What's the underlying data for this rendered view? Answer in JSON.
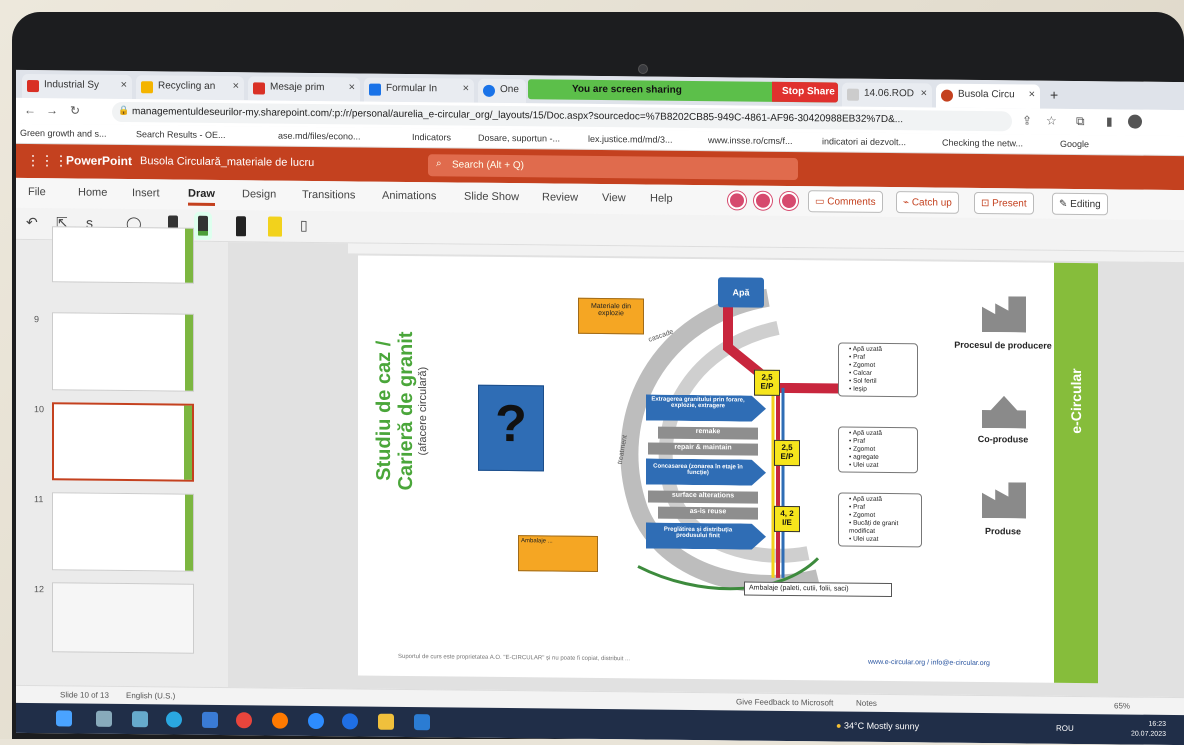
{
  "browser": {
    "tabs": [
      {
        "label": "Industrial Sy",
        "color": "#d93025"
      },
      {
        "label": "Recycling an",
        "color": "#f4b400"
      },
      {
        "label": "Mesaje prim",
        "color": "#d93025"
      },
      {
        "label": "Formular In",
        "color": "#1a73e8"
      },
      {
        "label": "One",
        "color": "#1a73e8"
      },
      {
        "label": "14.06.ROD",
        "color": "#cccccc"
      },
      {
        "label": "Busola Circu",
        "color": "#c4411f"
      }
    ],
    "share_banner": "You are screen sharing",
    "stop_share": "Stop Share",
    "url": "managementuldeseurilor-my.sharepoint.com/:p:/r/personal/aurelia_e-circular_org/_layouts/15/Doc.aspx?sourcedoc=%7B8202CB85-949C-4861-AF96-30420988EB32%7D&...",
    "bookmarks": [
      "Green growth and s...",
      "Search Results - OE...",
      "ase.md/files/econo...",
      "Indicators",
      "Dosare, suportun -...",
      "lex.justice.md/md/3...",
      "www.insse.ro/cms/f...",
      "indicatori ai dezvolt...",
      "Checking the netw...",
      "Google"
    ]
  },
  "powerpoint": {
    "app_name": "PowerPoint",
    "doc_title": "Busola Circulară_materiale de lucru",
    "search_placeholder": "Search (Alt + Q)",
    "ribbon_tabs": [
      "File",
      "Home",
      "Insert",
      "Draw",
      "Design",
      "Transitions",
      "Animations",
      "Slide Show",
      "Review",
      "View",
      "Help"
    ],
    "active_tab": "Draw",
    "buttons": {
      "comments": "Comments",
      "catch_up": "Catch up",
      "present": "Present",
      "editing": "Editing"
    }
  },
  "thumbnails": [
    {
      "num": "9"
    },
    {
      "num": "10",
      "selected": true
    },
    {
      "num": "11"
    },
    {
      "num": "12"
    }
  ],
  "slide": {
    "title_line1": "Studiu de caz /",
    "title_line2": "Carieră de granit",
    "subtitle": "(afacere circulară)",
    "question_mark": "?",
    "top_box": "Apă",
    "orange_box": "Materiale din explozie",
    "arrows": [
      "Extragerea granitului prin forare, explozie, extragere",
      "remake",
      "repair & maintain",
      "Concasarea (zonarea în etaje în funcție)",
      "surface alterations",
      "as-is reuse",
      "Preglătirea și distribuția produsului finit"
    ],
    "arc_labels": [
      "cascade",
      "treatment"
    ],
    "yellow_boxes": [
      {
        "line1": "2,5",
        "line2": "E/P"
      },
      {
        "line1": "2,5",
        "line2": "E/P"
      },
      {
        "line1": "4, 2",
        "line2": "I/E"
      }
    ],
    "output_lists": [
      [
        "Apă uzată",
        "Praf",
        "Zgomot",
        "Calcar",
        "Sol fertil",
        "Ieșip"
      ],
      [
        "Apă uzată",
        "Praf",
        "Zgomot",
        "agregate",
        "Ulei uzat"
      ],
      [
        "Apă uzată",
        "Praf",
        "Zgomot",
        "Bucăți de granit modificat",
        "Ulei uzat"
      ]
    ],
    "bottom_orange": "Ambalaje ...",
    "packaging_box": "Ambalaje (paleti, cutii, folii, saci)",
    "right_labels": [
      "Procesul de producere",
      "Co-produse",
      "Produse"
    ],
    "brand": "e-Circular",
    "footer_text": "Suportul de curs este proprietatea A.O. \"E-CIRCULAR\" și nu poate fi copiat, distribuit ...",
    "footer_link": "www.e-circular.org / info@e-circular.org"
  },
  "statusbar": {
    "slide_info": "Slide 10 of 13",
    "language": "English (U.S.)",
    "feedback": "Give Feedback to Microsoft",
    "notes": "Notes",
    "zoom": "65%"
  },
  "taskbar": {
    "weather": "34°C  Mostly sunny",
    "lang": "ROU",
    "time": "16:23",
    "date": "20.07.2023"
  }
}
